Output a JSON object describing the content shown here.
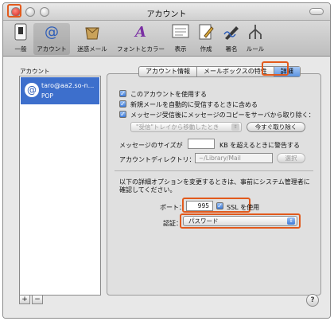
{
  "window": {
    "title": "アカウント"
  },
  "toolbar": {
    "items": [
      {
        "label": "一般",
        "icon": "switch-icon"
      },
      {
        "label": "アカウント",
        "icon": "at-sign-icon"
      },
      {
        "label": "迷惑メール",
        "icon": "junk-mail-icon"
      },
      {
        "label": "フォントとカラー",
        "icon": "font-color-icon"
      },
      {
        "label": "表示",
        "icon": "display-icon"
      },
      {
        "label": "作成",
        "icon": "compose-icon"
      },
      {
        "label": "署名",
        "icon": "signature-icon"
      },
      {
        "label": "ルール",
        "icon": "rules-icon"
      }
    ]
  },
  "sidebar": {
    "header": "アカウント",
    "accounts": [
      {
        "name": "taro@aa2.so-n...",
        "type": "POP"
      }
    ],
    "add_label": "+",
    "remove_label": "−"
  },
  "tabs": [
    {
      "label": "アカウント情報"
    },
    {
      "label": "メールボックスの特性"
    },
    {
      "label": "詳細"
    }
  ],
  "options": {
    "enable_account": "このアカウントを使用する",
    "include_auto_check": "新規メールを自動的に受信するときに含める",
    "remove_copy": "メッセージ受信後にメッセージのコピーをサーバから取り除く：",
    "remove_when": "\"受信\"トレイから移動したとき",
    "remove_now": "今すぐ取り除く",
    "size_warning_prefix": "メッセージのサイズが",
    "size_warning_value": "",
    "size_warning_suffix": "KB を超えるときに警告する",
    "account_dir_label": "アカウントディレクトリ：",
    "account_dir_value": "~/Library/Mail",
    "choose": "選択",
    "admin_note": "以下の詳細オプションを変更するときは、事前にシステム管理者に確認してください。",
    "port_label": "ポート：",
    "port_value": "995",
    "ssl_label": "SSL を使用",
    "auth_label": "認証：",
    "auth_value": "パスワード"
  },
  "help": {
    "label": "?"
  },
  "colors": {
    "highlight": "#e25a1c",
    "selection": "#3d6fcc",
    "active_tab": "#5b93e0"
  }
}
